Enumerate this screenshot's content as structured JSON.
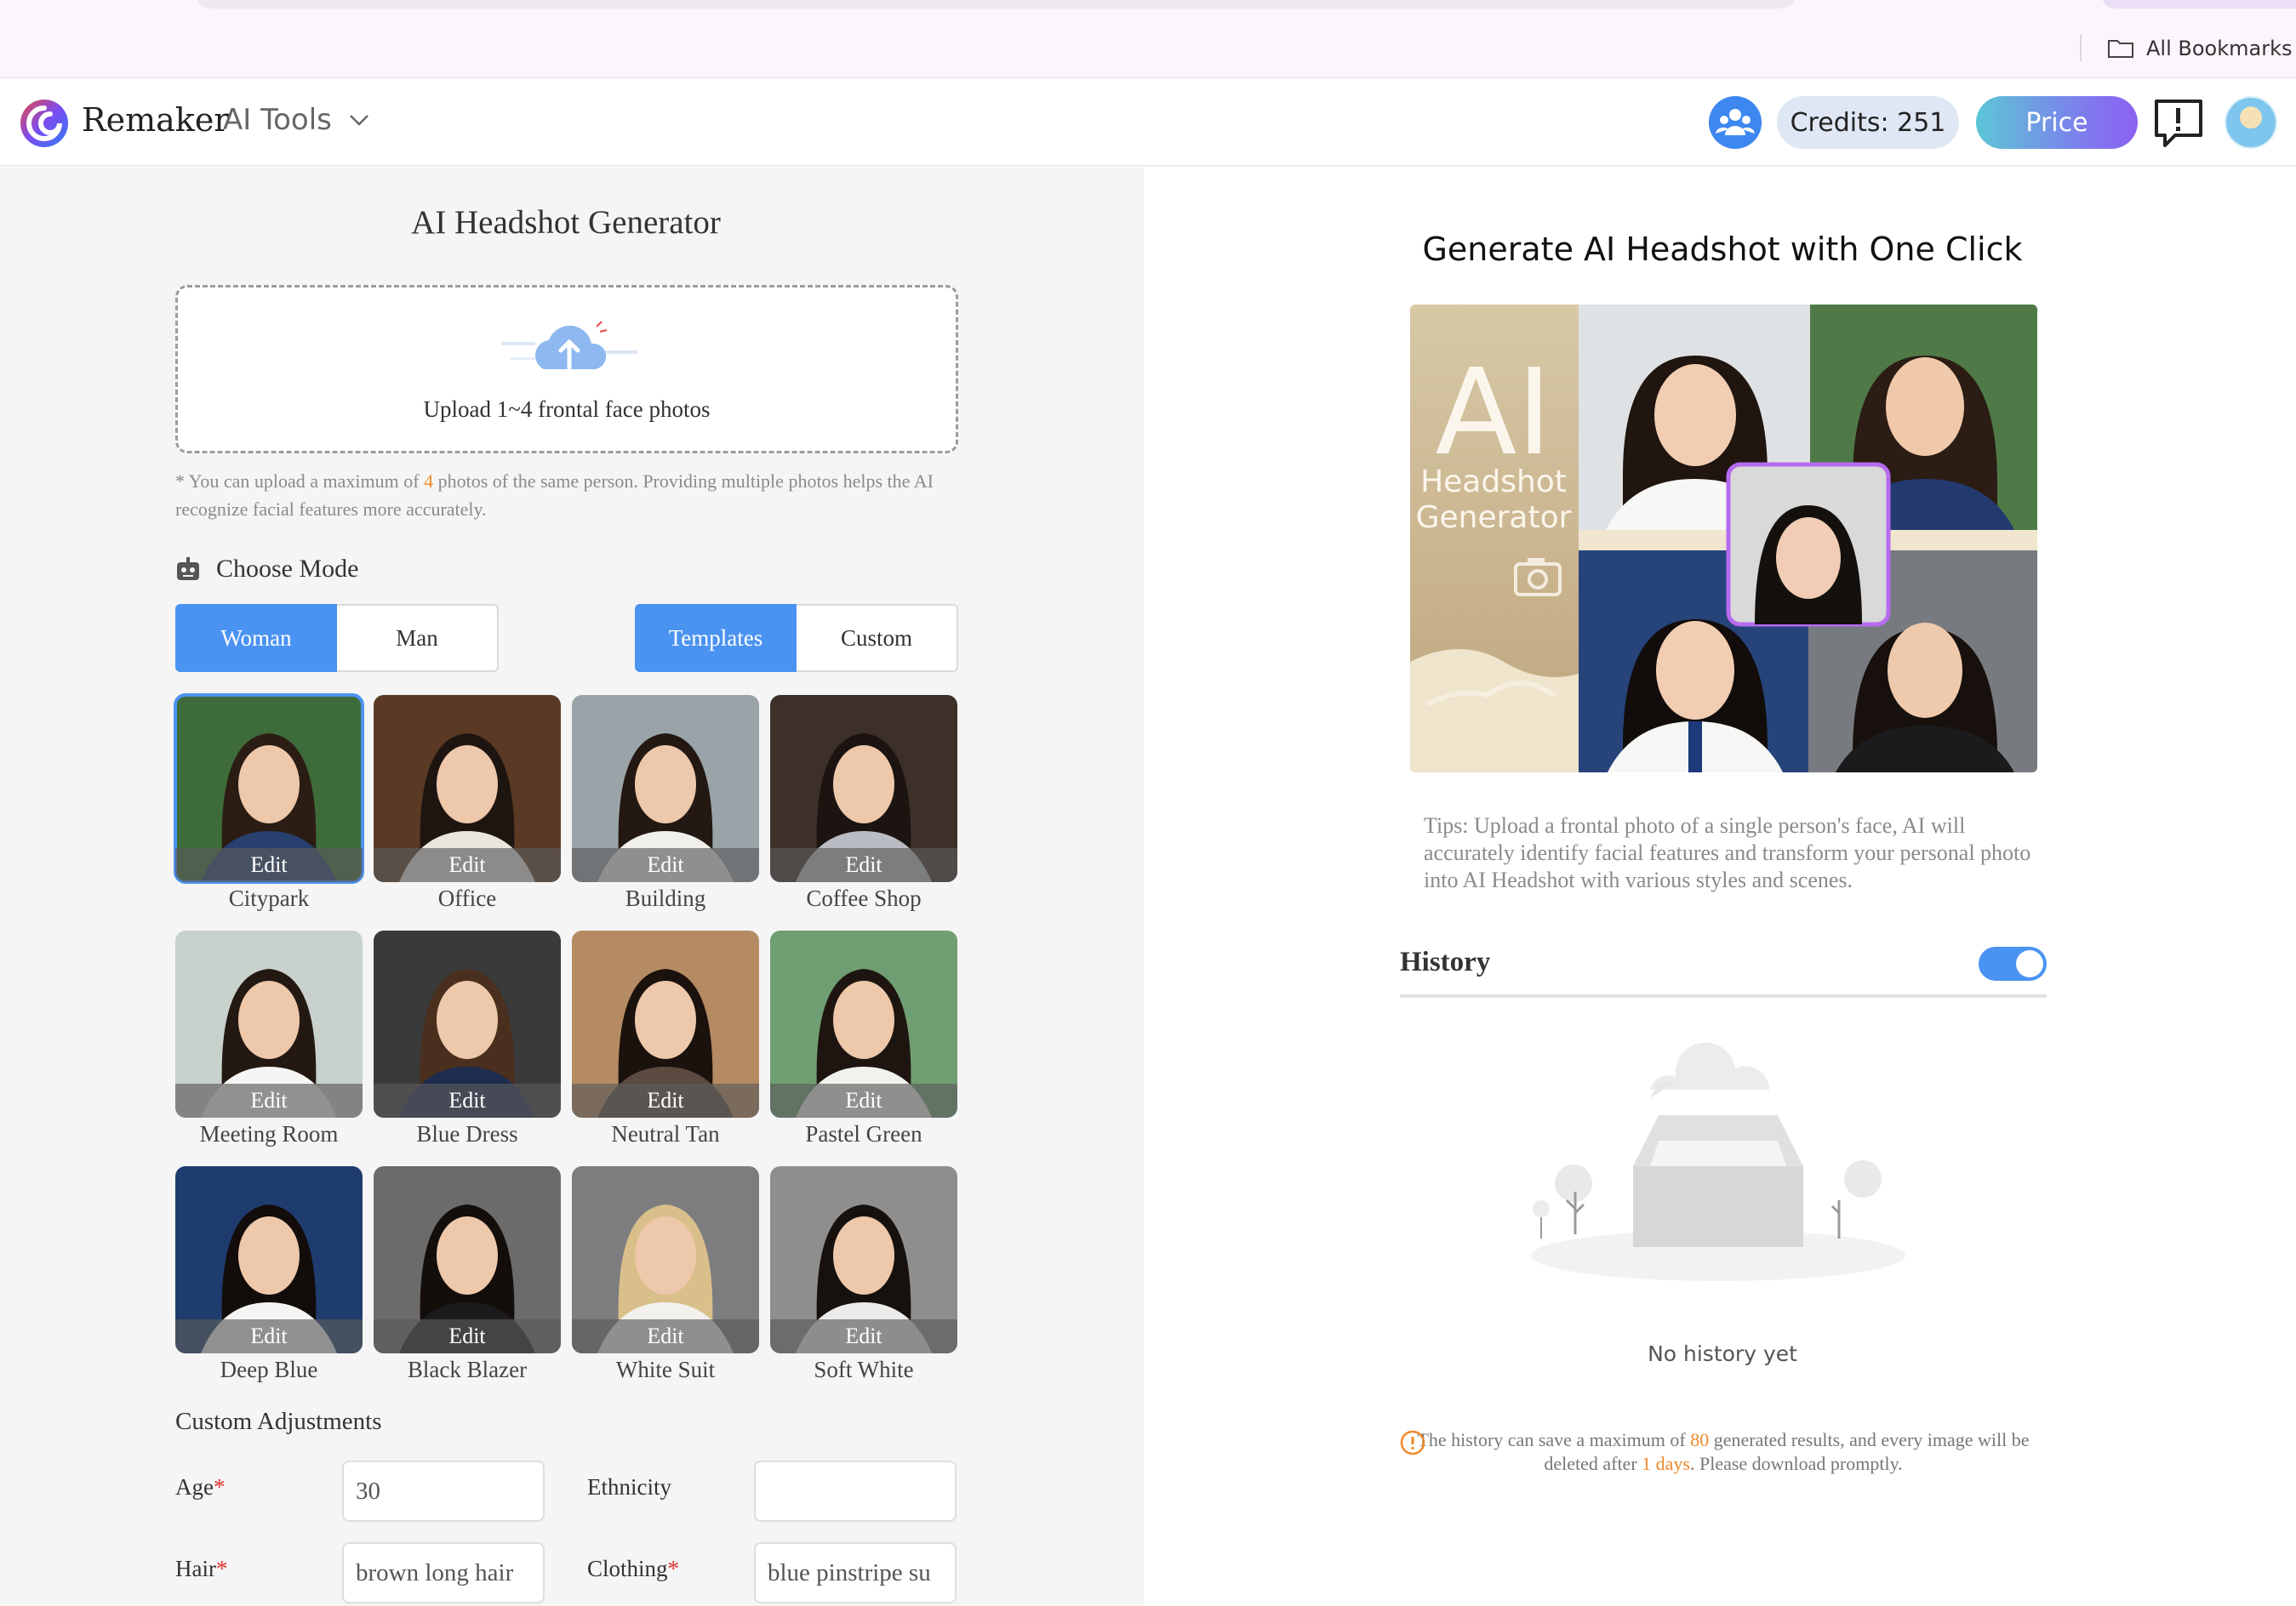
{
  "browser": {
    "bookmarks_label": "All Bookmarks"
  },
  "header": {
    "brand": "Remaker",
    "ai_tools_label": "AI Tools",
    "credits_label": "Credits: 251",
    "price_label": "Price"
  },
  "left": {
    "title": "AI Headshot Generator",
    "upload_text": "Upload 1~4 frontal face photos",
    "upload_note_prefix": "* You can upload a maximum of ",
    "upload_note_count": "4",
    "upload_note_suffix": " photos of the same person. Providing multiple photos helps the AI recognize facial features more accurately.",
    "choose_mode": "Choose Mode",
    "gender_tabs": [
      "Woman",
      "Man"
    ],
    "type_tabs": [
      "Templates",
      "Custom"
    ],
    "edit_label": "Edit",
    "templates": [
      {
        "label": "Citypark",
        "bg": "#3e6b3a",
        "hair": "#2b1d14",
        "outfit": "#27406f"
      },
      {
        "label": "Office",
        "bg": "#5a3a24",
        "hair": "#1f1510",
        "outfit": "#e9e6e0"
      },
      {
        "label": "Building",
        "bg": "#9aa4a8",
        "hair": "#231812",
        "outfit": "#f0efec"
      },
      {
        "label": "Coffee Shop",
        "bg": "#3d3028",
        "hair": "#1c1410",
        "outfit": "#b9bcc2"
      },
      {
        "label": "Meeting Room",
        "bg": "#c9d1cc",
        "hair": "#231812",
        "outfit": "#f5f5f3"
      },
      {
        "label": "Blue Dress",
        "bg": "#3a3a3a",
        "hair": "#4a2f1e",
        "outfit": "#1d2c4f"
      },
      {
        "label": "Neutral Tan",
        "bg": "#b58b63",
        "hair": "#1c120d",
        "outfit": "#5b4a40"
      },
      {
        "label": "Pastel Green",
        "bg": "#6f9e72",
        "hair": "#1f1510",
        "outfit": "#f1f1ee"
      },
      {
        "label": "Deep Blue",
        "bg": "#1f3c6e",
        "hair": "#120c0a",
        "outfit": "#f4f4f2"
      },
      {
        "label": "Black Blazer",
        "bg": "#6b6b6b",
        "hair": "#140e0b",
        "outfit": "#1b1b1d"
      },
      {
        "label": "White Suit",
        "bg": "#7d7d80",
        "hair": "#d9bf8a",
        "outfit": "#f2f1ee"
      },
      {
        "label": "Soft White",
        "bg": "#8e8e8e",
        "hair": "#17110d",
        "outfit": "#ebebea"
      }
    ],
    "custom_title": "Custom Adjustments",
    "fields": {
      "age_label": "Age",
      "age_value": "30",
      "ethnicity_label": "Ethnicity",
      "ethnicity_value": "",
      "hair_label": "Hair",
      "hair_value": "brown long hair",
      "clothing_label": "Clothing",
      "clothing_value": "blue pinstripe su"
    }
  },
  "right": {
    "title": "Generate AI Headshot with One Click",
    "promo_big": "AI",
    "promo_line1": "Headshot",
    "promo_line2": "Generator",
    "tips": "Tips: Upload a frontal photo of a single person's face, AI will accurately identify facial features and transform your personal photo into AI Headshot with various styles and scenes.",
    "history_title": "History",
    "no_history": "No history yet",
    "note_prefix": "The history can save a maximum of ",
    "note_count": "80",
    "note_mid": " generated results, and every image will be deleted after ",
    "note_days": "1 days",
    "note_suffix": ". Please download promptly."
  },
  "colors": {
    "accent": "#4b93f1",
    "highlight": "#f08a2c",
    "required": "#e0342f"
  }
}
